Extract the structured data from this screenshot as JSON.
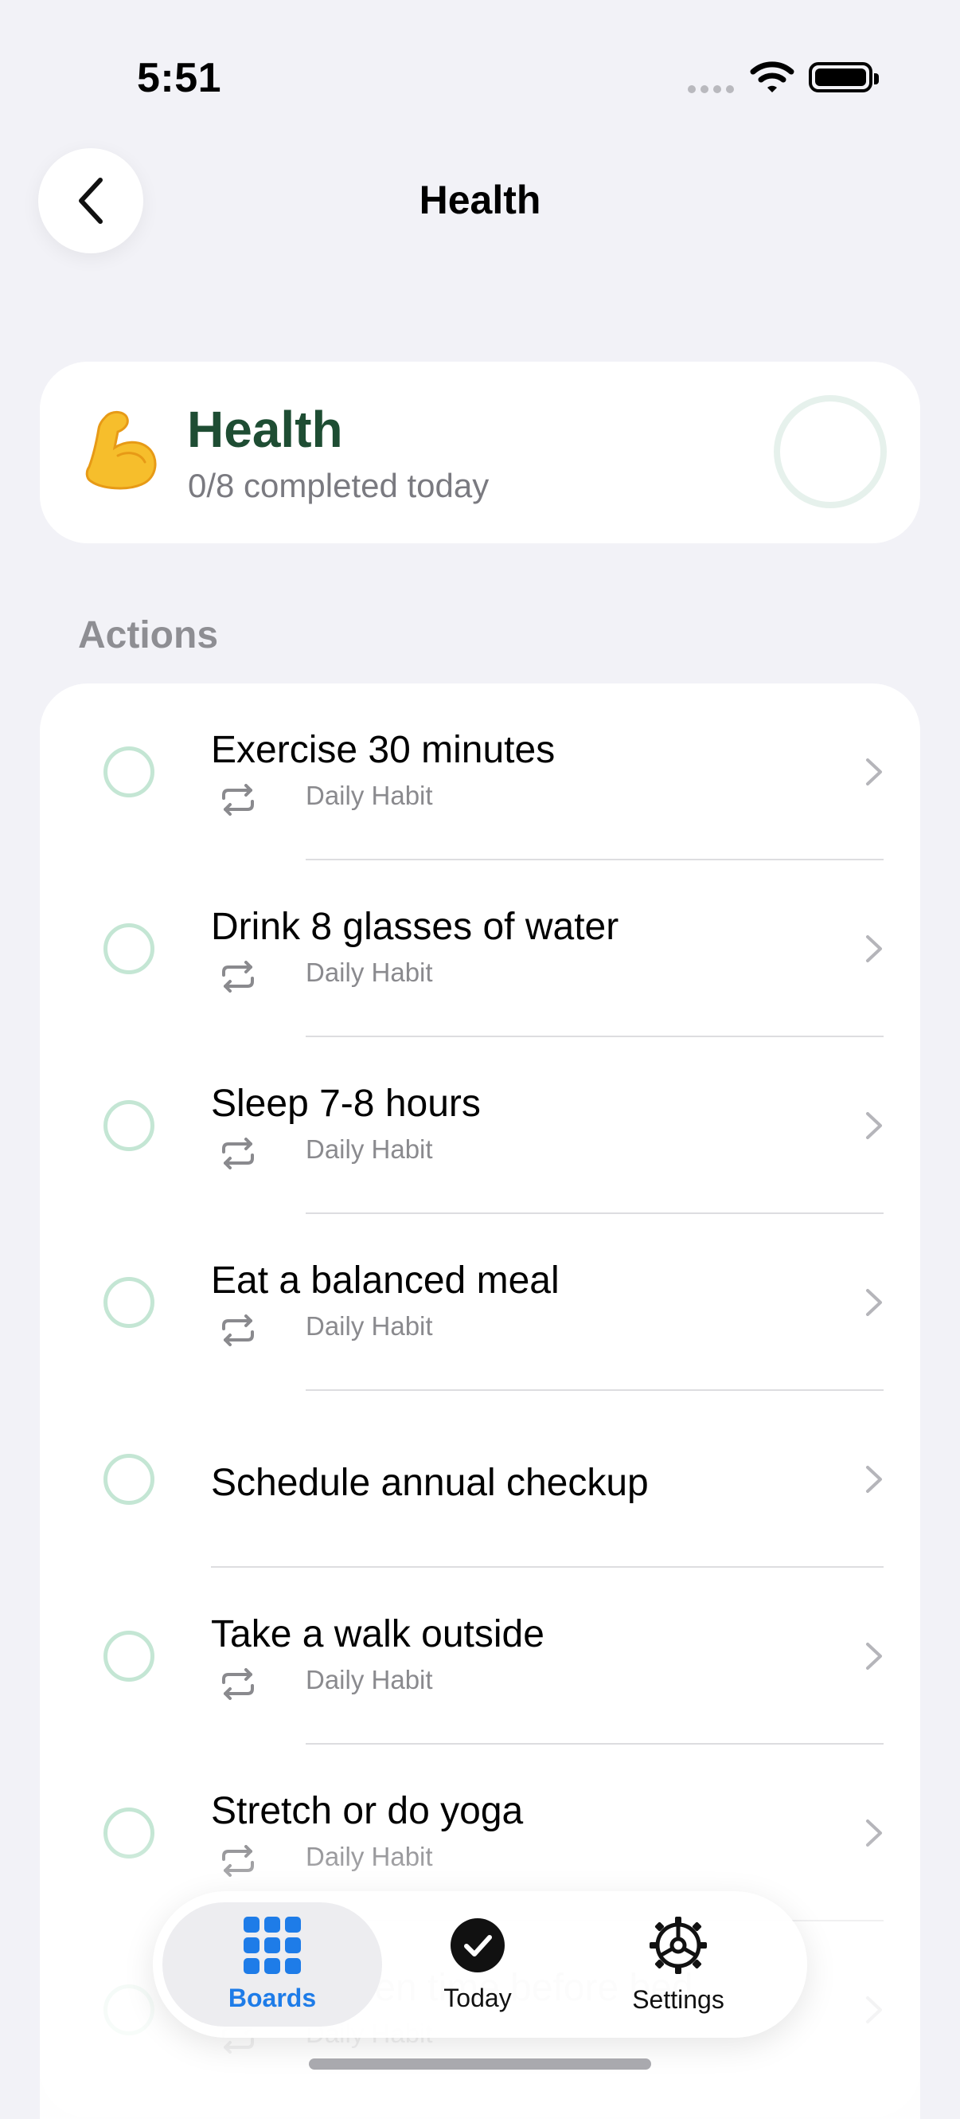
{
  "status_bar": {
    "time": "5:51"
  },
  "nav": {
    "title": "Health"
  },
  "board": {
    "emoji": "💪",
    "title": "Health",
    "subtitle": "0/8 completed today",
    "progress_fraction": 0
  },
  "section": {
    "label": "Actions"
  },
  "actions": [
    {
      "title": "Exercise 30 minutes",
      "subtitle": "Daily Habit"
    },
    {
      "title": "Drink 8 glasses of water",
      "subtitle": "Daily Habit"
    },
    {
      "title": "Sleep 7-8 hours",
      "subtitle": "Daily Habit"
    },
    {
      "title": "Eat a balanced meal",
      "subtitle": "Daily Habit"
    },
    {
      "title": "Schedule annual checkup",
      "subtitle": ""
    },
    {
      "title": "Take a walk outside",
      "subtitle": "Daily Habit"
    },
    {
      "title": "Stretch or do yoga",
      "subtitle": "Daily Habit"
    },
    {
      "title": "Limit screen time before bed",
      "subtitle": "Daily Habit"
    }
  ],
  "tabs": [
    {
      "label": "Boards",
      "icon": "grid-icon",
      "active": true
    },
    {
      "label": "Today",
      "icon": "checkmark-circle-icon",
      "active": false
    },
    {
      "label": "Settings",
      "icon": "gear-icon",
      "active": false
    }
  ],
  "colors": {
    "accent": "#1E7CE8",
    "board_title": "#1E4D33",
    "check_ring": "#C4E6D4"
  }
}
